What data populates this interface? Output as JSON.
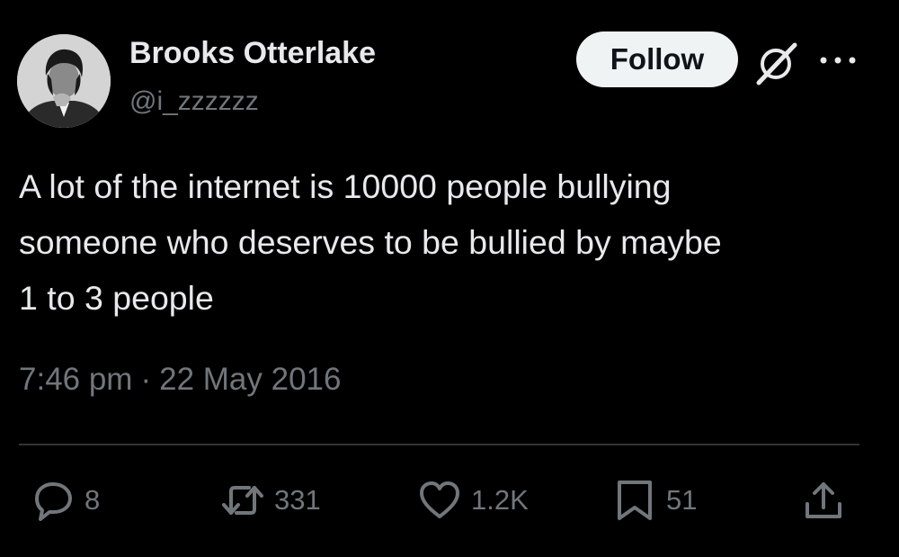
{
  "author": {
    "display_name": "Brooks Otterlake",
    "handle": "@i_zzzzzz"
  },
  "header": {
    "follow_label": "Follow"
  },
  "tweet": {
    "lines": [
      "A lot of the internet is 10000 people bullying",
      "someone who deserves to be bullied by maybe",
      "1 to 3 people"
    ],
    "time": "7:46 pm",
    "separator": "·",
    "date": "22 May 2016"
  },
  "actions": {
    "replies": "8",
    "reposts": "331",
    "likes": "1.2K",
    "bookmarks": "51"
  },
  "icons": {
    "avatar": "avatar-photo",
    "grok": "grok-icon",
    "more": "more-options-icon",
    "reply": "reply-icon",
    "repost": "repost-icon",
    "like": "heart-icon",
    "bookmark": "bookmark-icon",
    "share": "share-icon"
  },
  "colors": {
    "background": "#000000",
    "text_primary": "#e7e9ea",
    "text_secondary": "#71767b",
    "divider": "#2f3336",
    "follow_button_bg": "#eff3f4",
    "follow_button_text": "#0f1419"
  }
}
